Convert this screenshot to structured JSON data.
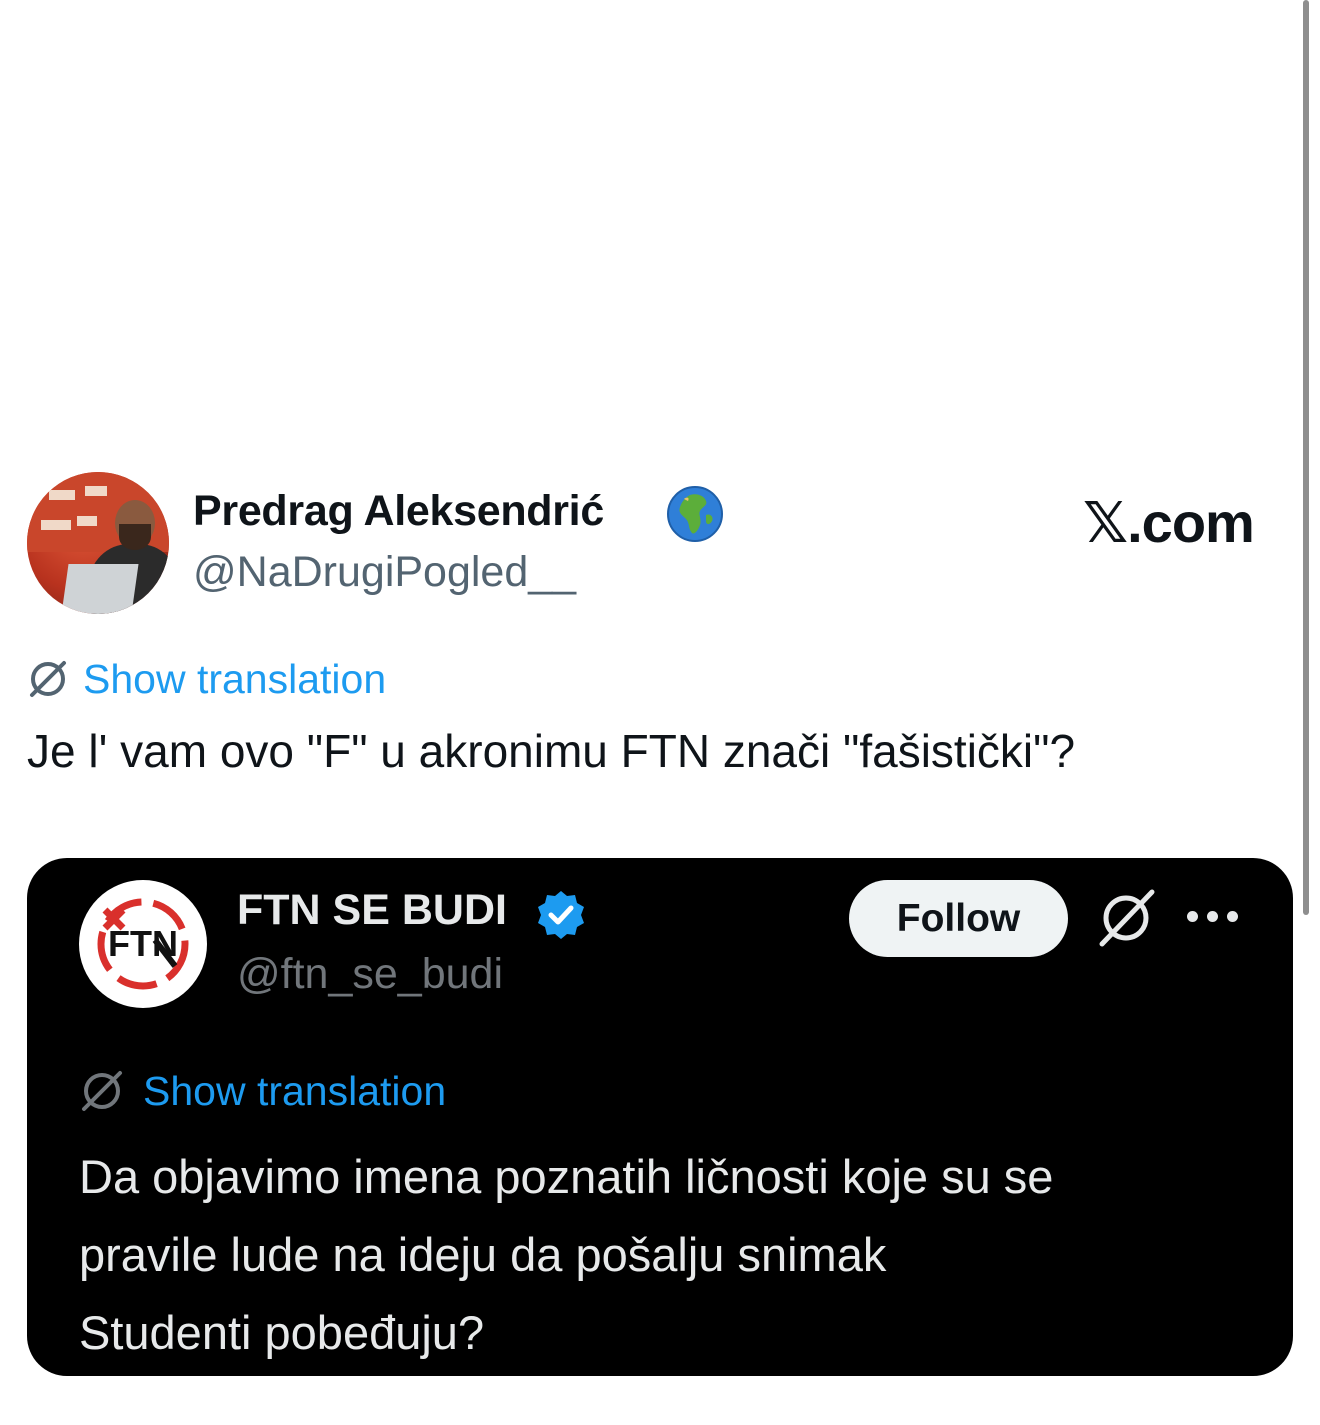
{
  "outer_tweet": {
    "author_name": "Predrag Aleksendrić",
    "author_handle": "@NaDrugiPogled__",
    "badge_icon": "globe-africa-europe-emoji",
    "show_translation": "Show translation",
    "text": "Je l' vam ovo \"F\" u akronimu FTN znači \"fašistički\"?"
  },
  "brand": {
    "site": "𝕏.com"
  },
  "quoted_screenshot": {
    "author_name": "FTN SE BUDI",
    "author_handle": "@ftn_se_budi",
    "verified_icon": "verified-badge-icon",
    "follow_label": "Follow",
    "show_translation": "Show translation",
    "text_lines": [
      "Da objavimo imena poznatih ličnosti koje su se",
      "pravile lude na ideju da pošalju snimak",
      "Studenti pobeđuju?"
    ],
    "avatar_text": "FTN"
  },
  "colors": {
    "link_blue": "#1d9bf0",
    "verified_blue": "#1d9bf0",
    "card_bg": "#000000",
    "text_dark": "#0f1419",
    "text_muted": "#536471"
  }
}
